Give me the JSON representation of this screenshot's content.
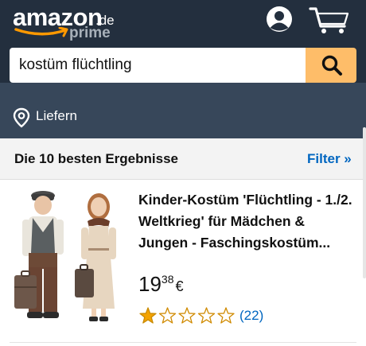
{
  "brand": {
    "word": "amazon",
    "tld": ".de",
    "tier": "prime"
  },
  "icons": {
    "account": "account-icon",
    "cart": "cart-icon",
    "search": "search-icon",
    "location": "location-pin-icon"
  },
  "colors": {
    "header_bg": "#232f3e",
    "subbar_bg": "#37475a",
    "search_button": "#febd69",
    "link_blue": "#0066c0",
    "star_fill": "#f4a300"
  },
  "search": {
    "value": "kostüm flüchtling"
  },
  "deliver": {
    "label": "Liefern"
  },
  "results": {
    "heading": "Die 10 besten Ergebnisse",
    "filter_label": "Filter »"
  },
  "product": {
    "title": "Kinder-Kostüm 'Flüchtling - 1./2. Weltkrieg' für Mädchen & Jungen - Faschingskostüm...",
    "price_whole": "19",
    "price_fraction": "38",
    "currency": "€",
    "rating": 1,
    "rating_max": 5,
    "review_count": "(22)"
  }
}
